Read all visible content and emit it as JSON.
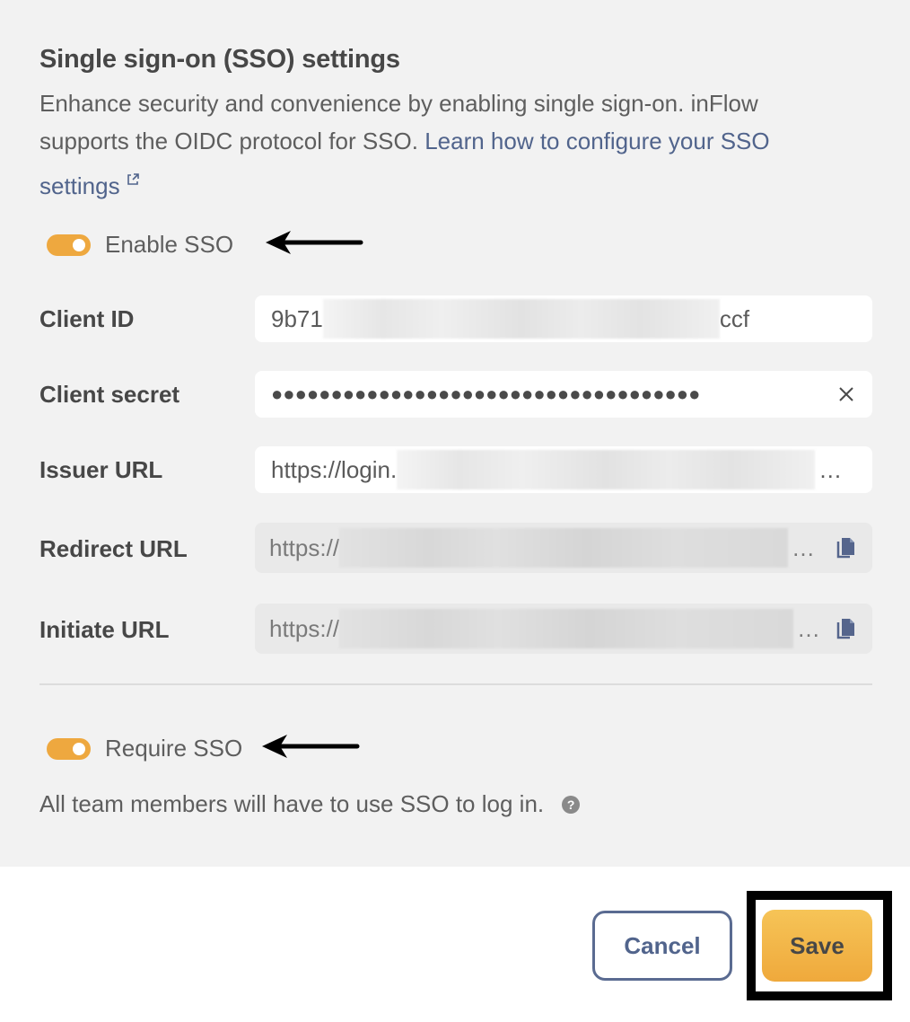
{
  "section": {
    "title": "Single sign-on (SSO) settings",
    "description_prefix": "Enhance security and convenience by enabling single sign-on. inFlow supports the OIDC protocol for SSO. ",
    "learn_link": "Learn how to configure your SSO settings",
    "learn_link_icon": "external-link-icon"
  },
  "enable_sso": {
    "label": "Enable SSO",
    "enabled": true
  },
  "fields": {
    "client_id": {
      "label": "Client ID",
      "value_start": "9b71",
      "value_end": "ccf",
      "redacted": true
    },
    "client_secret": {
      "label": "Client secret",
      "masked_value": "●●●●●●●●●●●●●●●●●●●●●●●●●●●●●●●●●●●●",
      "clear_icon": "close-icon"
    },
    "issuer_url": {
      "label": "Issuer URL",
      "value_start": "https://login.",
      "ellipsis": "…",
      "redacted": true
    },
    "redirect_url": {
      "label": "Redirect URL",
      "value_start": "https://",
      "ellipsis": "…",
      "redacted": true,
      "readonly": true,
      "copy_icon": "copy-icon"
    },
    "initiate_url": {
      "label": "Initiate URL",
      "value_start": "https://",
      "ellipsis": "…",
      "redacted": true,
      "readonly": true,
      "copy_icon": "copy-icon"
    }
  },
  "require_sso": {
    "label": "Require SSO",
    "enabled": true,
    "hint": "All team members will have to use SSO to log in.",
    "help_icon": "?"
  },
  "footer": {
    "cancel_label": "Cancel",
    "save_label": "Save"
  },
  "colors": {
    "toggle_on": "#eea83f",
    "link": "#51648c",
    "save_button": "#f2b545",
    "panel_background": "#f2f2f2"
  }
}
